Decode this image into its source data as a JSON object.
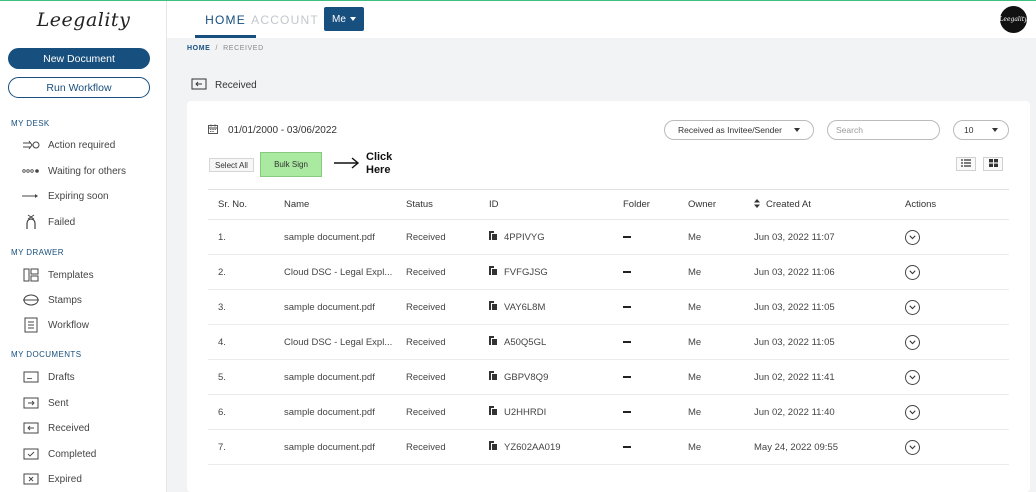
{
  "app": {
    "logo_text": "Leegality",
    "avatar_text": "Leegality"
  },
  "sidebar": {
    "new_document": "New Document",
    "run_workflow": "Run Workflow",
    "sections": [
      {
        "title": "MY DESK",
        "items": [
          {
            "label": "Action required",
            "icon": "action-required-icon"
          },
          {
            "label": "Waiting for others",
            "icon": "waiting-icon"
          },
          {
            "label": "Expiring soon",
            "icon": "expiring-icon"
          },
          {
            "label": "Failed",
            "icon": "failed-icon"
          }
        ]
      },
      {
        "title": "MY DRAWER",
        "items": [
          {
            "label": "Templates",
            "icon": "templates-icon"
          },
          {
            "label": "Stamps",
            "icon": "stamps-icon"
          },
          {
            "label": "Workflow",
            "icon": "workflow-icon"
          }
        ]
      },
      {
        "title": "MY DOCUMENTS",
        "items": [
          {
            "label": "Drafts",
            "icon": "drafts-icon"
          },
          {
            "label": "Sent",
            "icon": "sent-icon"
          },
          {
            "label": "Received",
            "icon": "received-icon"
          },
          {
            "label": "Completed",
            "icon": "completed-icon"
          },
          {
            "label": "Expired",
            "icon": "expired-icon"
          }
        ]
      }
    ]
  },
  "header": {
    "tabs": [
      "HOME",
      "ACCOUNT"
    ],
    "me_label": "Me"
  },
  "breadcrumb": {
    "home": "HOME",
    "sep": "/",
    "current": "RECEIVED"
  },
  "page": {
    "title": "Received"
  },
  "toolbar": {
    "date_range": "01/01/2000 - 03/06/2022",
    "filter_selected": "Received as Invitee/Sender",
    "search_placeholder": "Search",
    "per_page": "10",
    "select_all": "Select All",
    "bulk_sign": "Bulk Sign",
    "annotation": "Click Here"
  },
  "table": {
    "headers": [
      "Sr. No.",
      "Name",
      "Status",
      "ID",
      "Folder",
      "Owner",
      "Created At",
      "Actions"
    ],
    "rows": [
      {
        "sr": "1.",
        "name": "sample document.pdf",
        "status": "Received",
        "id": "4PPIVYG",
        "owner": "Me",
        "created": "Jun 03, 2022 11:07"
      },
      {
        "sr": "2.",
        "name": "Cloud DSC - Legal Expl...",
        "status": "Received",
        "id": "FVFGJSG",
        "owner": "Me",
        "created": "Jun 03, 2022 11:06"
      },
      {
        "sr": "3.",
        "name": "sample document.pdf",
        "status": "Received",
        "id": "VAY6L8M",
        "owner": "Me",
        "created": "Jun 03, 2022 11:05"
      },
      {
        "sr": "4.",
        "name": "Cloud DSC - Legal Expl...",
        "status": "Received",
        "id": "A50Q5GL",
        "owner": "Me",
        "created": "Jun 03, 2022 11:05"
      },
      {
        "sr": "5.",
        "name": "sample document.pdf",
        "status": "Received",
        "id": "GBPV8Q9",
        "owner": "Me",
        "created": "Jun 02, 2022 11:41"
      },
      {
        "sr": "6.",
        "name": "sample document.pdf",
        "status": "Received",
        "id": "U2HHRDI",
        "owner": "Me",
        "created": "Jun 02, 2022 11:40"
      },
      {
        "sr": "7.",
        "name": "sample document.pdf",
        "status": "Received",
        "id": "YZ602AA019",
        "owner": "Me",
        "created": "May 24, 2022 09:55"
      }
    ]
  },
  "colors": {
    "brand": "#174f7e",
    "bulk_sign_bg": "#a9e9a0",
    "background": "#f2f3f5"
  }
}
